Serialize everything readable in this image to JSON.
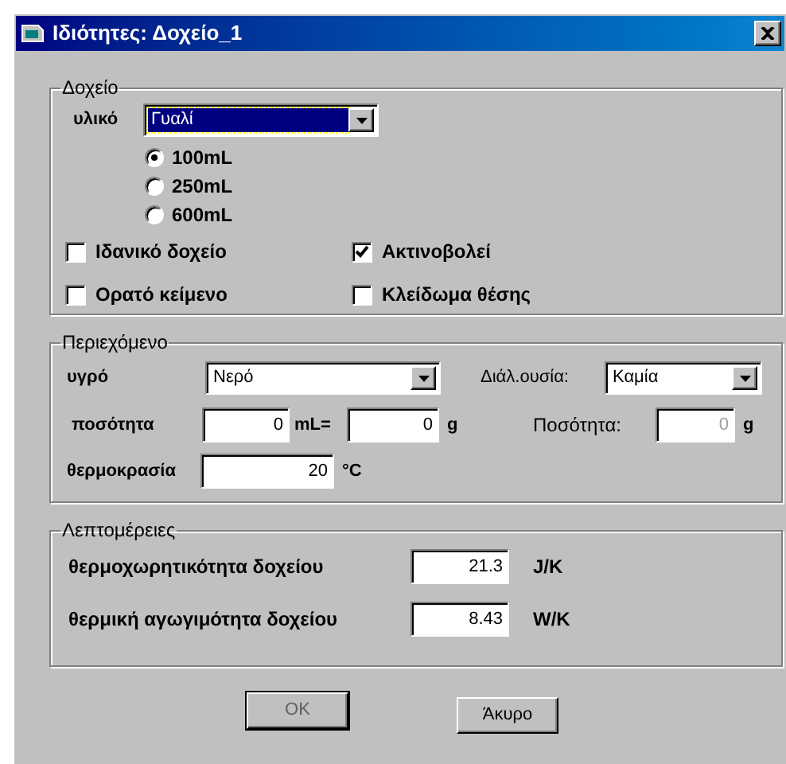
{
  "window": {
    "title": "Ιδιότητες: Δοχείο_1"
  },
  "container": {
    "legend": "Δοχείο",
    "material": {
      "label": "υλικό",
      "value": "Γυαλί"
    },
    "sizes": [
      {
        "label": "100mL",
        "selected": true
      },
      {
        "label": "250mL",
        "selected": false
      },
      {
        "label": "600mL",
        "selected": false
      }
    ],
    "options": [
      {
        "label": "Ιδανικό δοχείο",
        "checked": false
      },
      {
        "label": "Ακτινοβολεί",
        "checked": true
      },
      {
        "label": "Ορατό κείμενο",
        "checked": false
      },
      {
        "label": "Κλείδωμα θέσης",
        "checked": false
      }
    ]
  },
  "contents": {
    "legend": "Περιεχόμενο",
    "liquid": {
      "label": "υγρό",
      "value": "Νερό"
    },
    "solute": {
      "label": "Διάλ.ουσία:",
      "value": "Καμία"
    },
    "amount": {
      "label": "ποσότητα",
      "volume": "0",
      "volume_unit": "mL=",
      "mass": "0",
      "mass_unit": "g"
    },
    "solute_amount": {
      "label": "Ποσότητα:",
      "value": "0",
      "unit": "g",
      "disabled": true
    },
    "temperature": {
      "label": "θερμοκρασία",
      "value": "20",
      "unit": "°C"
    }
  },
  "details": {
    "legend": "Λεπτομέρειες",
    "rows": [
      {
        "label": "θερμοχωρητικότητα δοχείου",
        "value": "21.3",
        "unit": "J/K"
      },
      {
        "label": "θερμική αγωγιμότητα δοχείου",
        "value": "8.43",
        "unit": "W/K"
      }
    ]
  },
  "buttons": [
    {
      "label": "OK"
    },
    {
      "label": "Άκυρο"
    }
  ]
}
